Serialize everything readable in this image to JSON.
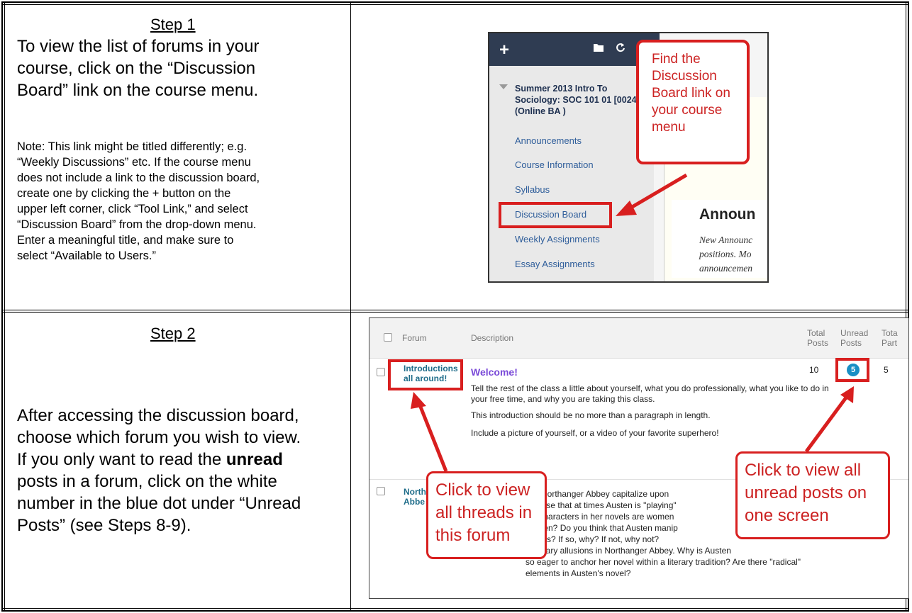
{
  "step1": {
    "title": "Step 1",
    "main_line1": "To view the list of forums in your",
    "main_line2": "course, click on the “Discussion",
    "main_line3": "Board” link on the course menu.",
    "note_lines": [
      "Note: This link might be titled differently; e.g.",
      "“Weekly Discussions” etc. If the course menu",
      "does not include a link to the discussion board,",
      "create one by clicking the + button on the",
      "upper left corner, click “Tool Link,” and select",
      "“Discussion Board” from the drop-down menu.",
      "Enter a meaningful title, and make sure to",
      "select “Available to Users.”"
    ]
  },
  "step2": {
    "title": "Step 2",
    "line1": "After accessing the discussion board,",
    "line2": "choose which forum you wish to view.",
    "line3_pre": "If you only want to read the ",
    "line3_bold": "unread",
    "line4": "posts in a forum, click on the white",
    "line5": "number in the blue dot under “Unread",
    "line6": "Posts” (see Steps 8-9)."
  },
  "shot1": {
    "plus": "+",
    "folder_icon": "folder-icon",
    "refresh_icon": "refresh-icon",
    "course_title": "Summer 2013 Intro To Sociology: SOC 101 01 [0024] (Online BA )",
    "menu_items": [
      "Announcements",
      "Course Information",
      "Syllabus",
      "Discussion Board",
      "Weekly Assignments",
      "Essay Assignments"
    ],
    "content_heading": "Announ",
    "content_italic": [
      "New Announc",
      "positions. Mo",
      "announcemen"
    ],
    "callout": "Find the Discussion Board link on your course menu",
    "accent": "#d81f1f"
  },
  "shot2": {
    "headers": {
      "forum": "Forum",
      "description": "Description",
      "total_posts": "Total Posts",
      "unread_posts": "Unread Posts",
      "total_participants": "Tota Part"
    },
    "row1": {
      "forum": "Introductions all around!",
      "title": "Welcome!",
      "p1": "Tell the rest of the class a little about yourself, what you do professionally, what you like to do in your free time, and why you are taking this class.",
      "p2": "This introduction should be no more than a paragraph in length.",
      "p3": "Include a picture of yourself, or a video of your favorite superhero!",
      "total": "10",
      "unread": "5",
      "participants": "5"
    },
    "row2": {
      "forum": "North Abbe",
      "lines": [
        "ces Northanger Abbey capitalize upon",
        "u sense that at times Austen is \"playing\"",
        "pal characters in her novels are women",
        "women? Do you think that Austen manip",
        "n ends? If so, why? If not, why not?",
        "y literary allusions in Northanger Abbey. Why is Austen",
        "so eager to anchor her novel within a literary tradition? Are there \"radical\"",
        "elements in Austen's novel?"
      ]
    },
    "callout_left": "Click to view all threads in this forum",
    "callout_right": "Click to view all unread posts on one screen",
    "dot_color": "#1a8fc4"
  }
}
